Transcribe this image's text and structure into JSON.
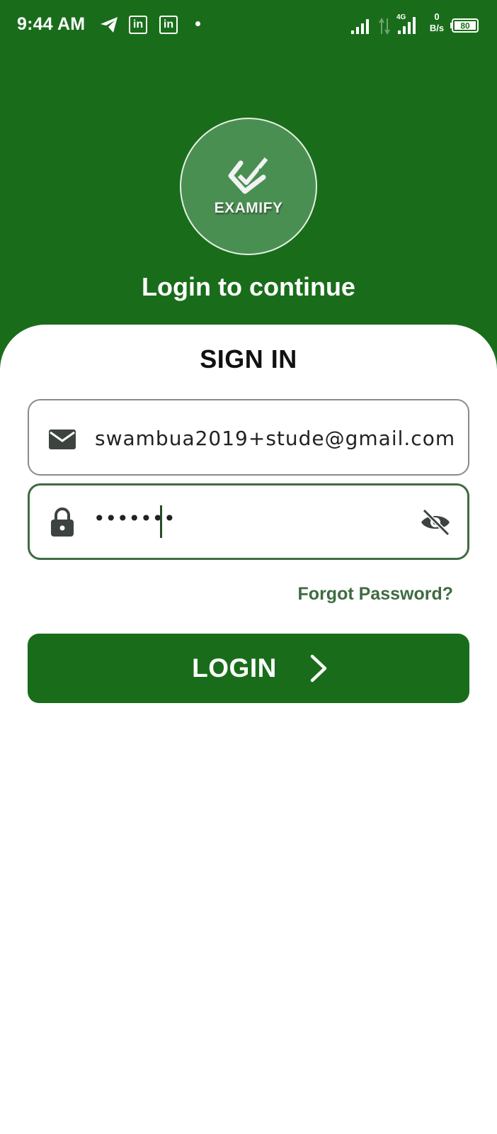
{
  "status_bar": {
    "time": "9:44 AM",
    "notification_icons": [
      "telegram-icon",
      "linkedin-icon",
      "linkedin-icon"
    ],
    "linkedin_glyph": "in",
    "net_speed_value": "0",
    "net_speed_unit": "B/s",
    "network_type": "4G",
    "battery_level": "80"
  },
  "logo": {
    "text": "EXAMIFY"
  },
  "header": {
    "title": "Login to continue"
  },
  "form": {
    "title": "SIGN IN",
    "email": {
      "value": "swambua2019+stude@gmail.com",
      "icon": "mail-icon"
    },
    "password": {
      "value": "•••••••",
      "lock_icon": "lock-icon",
      "toggle_icon": "eye-off-icon"
    },
    "forgot_password": "Forgot Password?",
    "login_button": "LOGIN"
  },
  "colors": {
    "primary_green": "#196d1a",
    "focus_border": "#3e6b41",
    "logo_circle": "#4a8f52"
  }
}
